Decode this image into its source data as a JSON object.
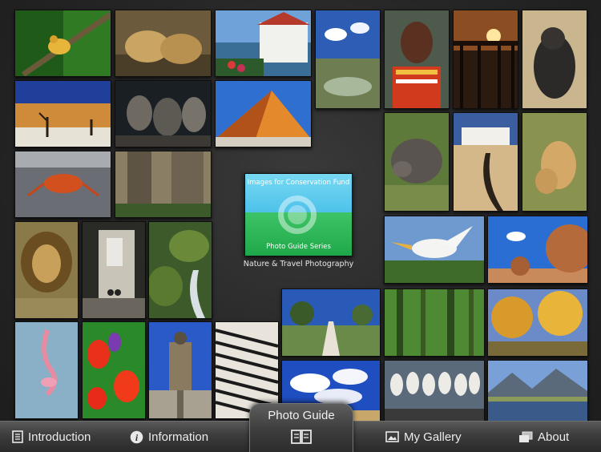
{
  "logo": {
    "title": "Images for Conservation Fund",
    "subtitle": "Photo Guide Series",
    "caption": "Nature & Travel Photography"
  },
  "toolbar": {
    "introduction": "Introduction",
    "information": "Information",
    "photo_guide": "Photo Guide",
    "my_gallery": "My Gallery",
    "about": "About"
  },
  "photos": [
    "frog",
    "lions",
    "seaside-house",
    "wetland",
    "maasai-portrait",
    "pier-sunset",
    "sea-lion",
    "desert-trees",
    "iguanas",
    "sand-dune",
    "crab",
    "tree-trunk",
    "hippo",
    "mission-palm",
    "lioness",
    "lion",
    "alley",
    "waterfall",
    "pelican",
    "boulder",
    "boardwalk",
    "forest-blur",
    "autumn-trees",
    "flamingo",
    "tulips",
    "monument",
    "zebras",
    "clouds",
    "storks",
    "mountain-lake"
  ]
}
